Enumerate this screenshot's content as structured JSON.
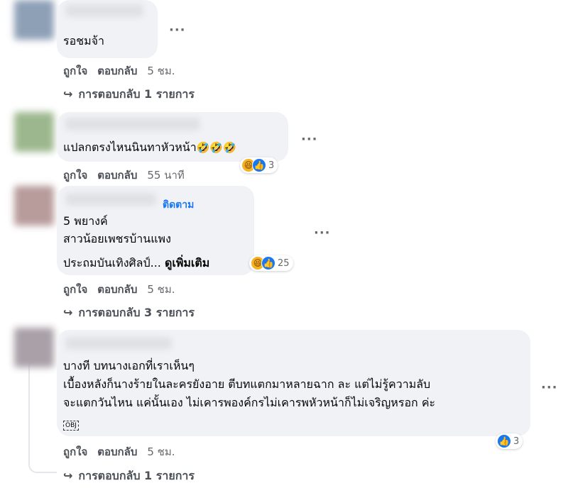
{
  "comments": [
    {
      "text": "รอชมจ้า",
      "actions": {
        "like": "ถูกใจ",
        "reply": "ตอบกลับ",
        "time": "5 ชม."
      },
      "replies_toggle": "การตอบกลับ 1 รายการ"
    },
    {
      "text": "แปลกตรงไหนนินทาหัวหน้า",
      "emoji": "🤣🤣🤣",
      "reaction_count": "3",
      "actions": {
        "like": "ถูกใจ",
        "reply": "ตอบกลับ",
        "time": "55 นาที"
      }
    },
    {
      "follow": "ติดตาม",
      "lines": [
        "5 พยางค์",
        "สาวน้อยเพชรบ้านแพง",
        "ประถมบันเทิงศิลป์..."
      ],
      "see_more": "ดูเพิ่มเติม",
      "reaction_count": "25",
      "actions": {
        "like": "ถูกใจ",
        "reply": "ตอบกลับ",
        "time": "5 ชม."
      },
      "replies_toggle": "การตอบกลับ 3 รายการ"
    },
    {
      "lines": [
        "บางที บทนางเอกที่เราเห็นๆ",
        "เบื้องหลังก็นางร้ายในละครยังอาย ตีบทแตกมาหลายฉาก ละ แต่ไม่รู้ความลับ",
        "จะแตกวันไหน แค่นั้นเอง ไม่เคารพองค์กรไม่เคารพหัวหน้าก็ไม่เจริญหรอก ค่ะ"
      ],
      "obj_glyph": "OBJ",
      "reaction_count": "3",
      "actions": {
        "like": "ถูกใจ",
        "reply": "ตอบกลับ",
        "time": "5 ชม."
      },
      "replies_toggle": "การตอบกลับ 1 รายการ"
    }
  ],
  "more_glyph": "···",
  "reply_arrow": "↪",
  "icons": {
    "haha": "😆",
    "like": "👍"
  },
  "colors": {
    "bubble": "#f0f2f5",
    "link": "#1877f2",
    "meta": "#65676b"
  }
}
